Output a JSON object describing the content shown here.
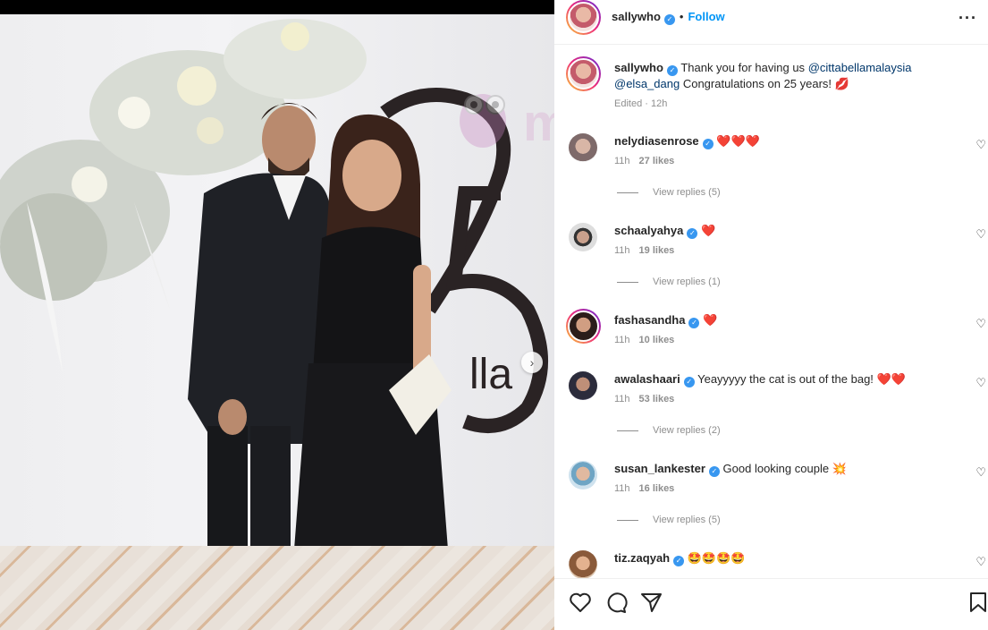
{
  "post": {
    "author": "sallywho",
    "separator": "•",
    "follow_label": "Follow",
    "more_label": "···",
    "caption_author": "sallywho",
    "caption_text_1": "Thank you for having us",
    "caption_mention_1": "@cittabellamalaysia",
    "caption_mention_2": "@elsa_dang",
    "caption_text_2": "Congratulations on 25 years!",
    "caption_emoji": "💋",
    "edited": "Edited · 12h",
    "photo_sign_text": "25",
    "photo_sign_brand": "lla",
    "watermark": "mur i"
  },
  "comments": [
    {
      "user": "nelydiasenrose",
      "text": "❤️❤️❤️",
      "time": "11h",
      "likes": "27 likes",
      "replies": "View replies (5)"
    },
    {
      "user": "schaalyahya",
      "text": "❤️",
      "time": "11h",
      "likes": "19 likes",
      "replies": "View replies (1)"
    },
    {
      "user": "fashasandha",
      "text": "❤️",
      "time": "11h",
      "likes": "10 likes",
      "replies": ""
    },
    {
      "user": "awalashaari",
      "text": "Yeayyyyy the cat is out of the bag! ❤️❤️",
      "time": "11h",
      "likes": "53 likes",
      "replies": "View replies (2)"
    },
    {
      "user": "susan_lankester",
      "text": "Good looking couple 💥",
      "time": "11h",
      "likes": "16 likes",
      "replies": "View replies (5)"
    },
    {
      "user": "tiz.zaqyah",
      "text": "🤩🤩🤩🤩",
      "time": "",
      "likes": "",
      "replies": ""
    }
  ],
  "icons": {
    "verified": "✓",
    "comment_like": "♡",
    "next_arrow": "›"
  },
  "colors": {
    "follow_blue": "#0095f6",
    "verified_blue": "#3897f0",
    "mention_blue": "#00376b",
    "muted_gray": "#8e8e8e"
  }
}
